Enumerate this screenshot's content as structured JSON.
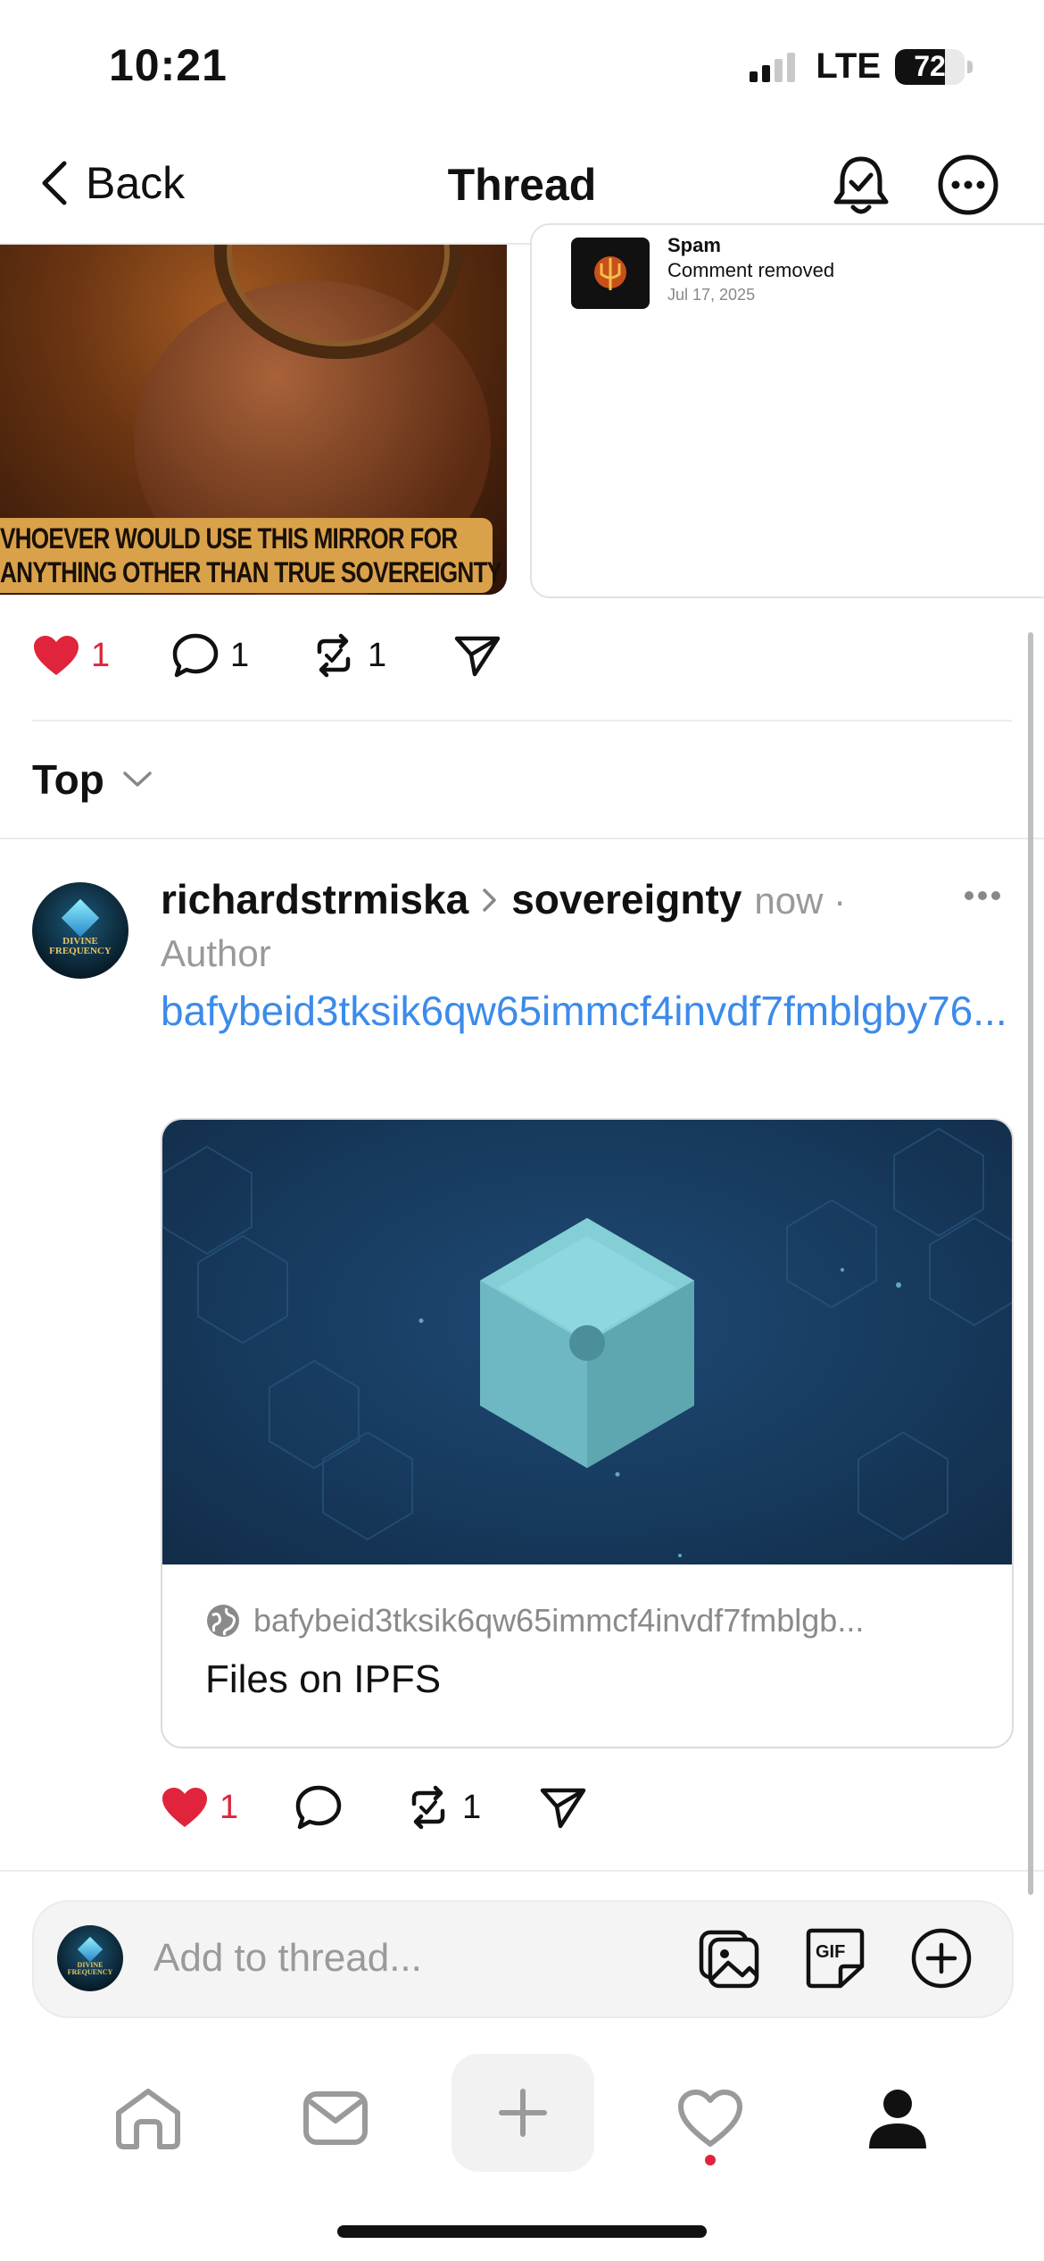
{
  "status_bar": {
    "time": "10:21",
    "network": "LTE",
    "battery": "72",
    "battery_level": 0.72
  },
  "header": {
    "back_label": "Back",
    "title": "Thread"
  },
  "top_post": {
    "image_banner_lines": [
      "VHOEVER WOULD USE THIS MIRROR FOR",
      "ANYTHING OTHER THAN TRUE SOVEREIGNTY"
    ],
    "side_card": {
      "label": "Spam",
      "status": "Comment removed",
      "date": "Jul 17, 2025"
    },
    "likes": "1",
    "comments": "1",
    "reposts": "1"
  },
  "sort": {
    "label": "Top"
  },
  "reply": {
    "avatar_lines": [
      "DIVINE",
      "FREQUENCY"
    ],
    "username": "richardstrmiska",
    "community": "sovereignty",
    "time": "now ·",
    "role": "Author",
    "link_text": "bafybeid3tksik6qw65immcf4invdf7fmblgby76...",
    "card": {
      "domain": "bafybeid3tksik6qw65immcf4invdf7fmblgb...",
      "title": "Files on IPFS"
    },
    "likes": "1",
    "reposts": "1"
  },
  "composer": {
    "placeholder": "Add to thread..."
  },
  "colors": {
    "accent_link": "#3c8bea",
    "like_red": "#e0243b"
  },
  "tabs": [
    "home-icon",
    "inbox-icon",
    "plus-icon",
    "heart-icon",
    "profile-icon"
  ]
}
